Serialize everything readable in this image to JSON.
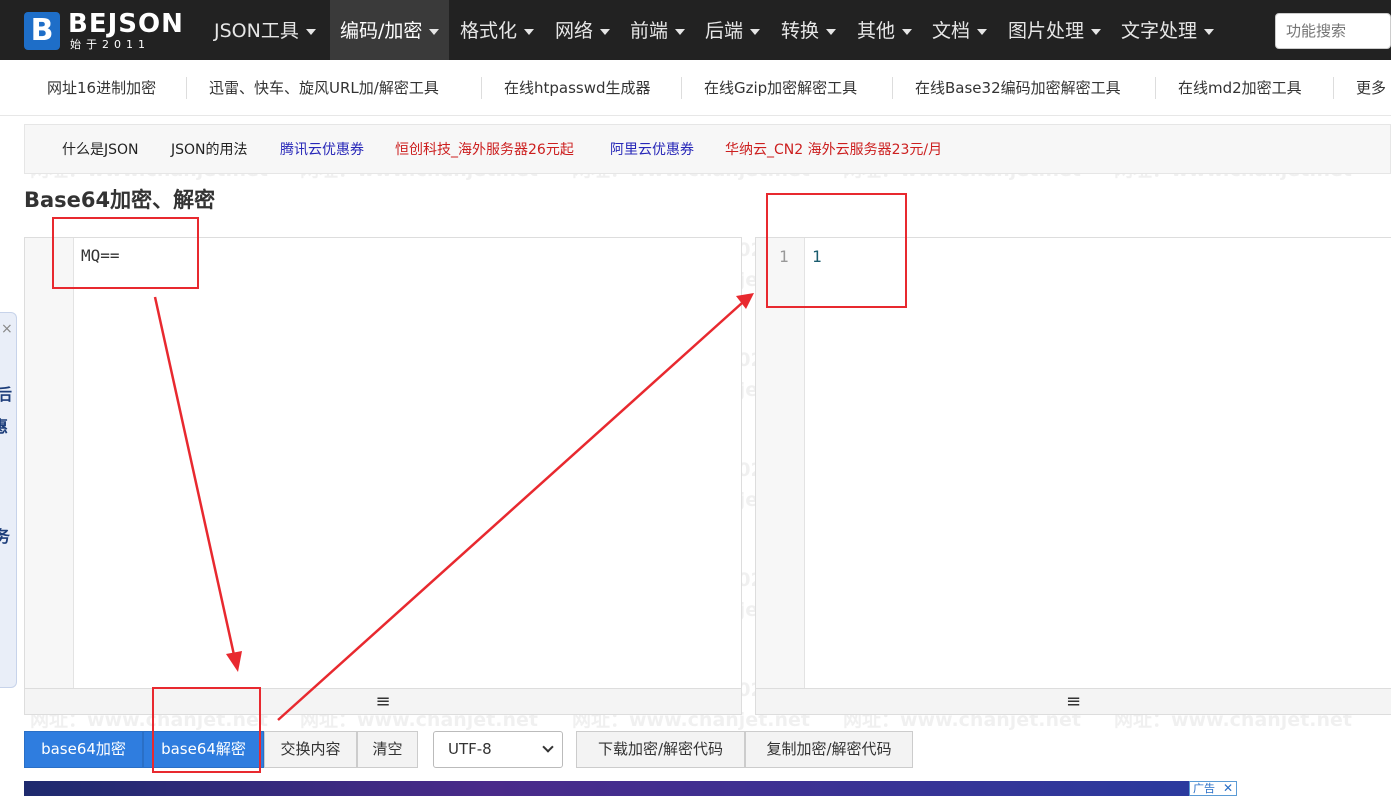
{
  "logo": {
    "box": "B",
    "main": "BEJSON",
    "sub": "始于2011"
  },
  "nav": {
    "items": [
      {
        "label": "JSON工具"
      },
      {
        "label": "编码/加密"
      },
      {
        "label": "格式化"
      },
      {
        "label": "网络"
      },
      {
        "label": "前端"
      },
      {
        "label": "后端"
      },
      {
        "label": "转换"
      },
      {
        "label": "其他"
      },
      {
        "label": "文档"
      },
      {
        "label": "图片处理"
      },
      {
        "label": "文字处理"
      }
    ],
    "search_placeholder": "功能搜索"
  },
  "subnav": {
    "items": [
      "网址16进制加密",
      "迅雷、快车、旋风URL加/解密工具",
      "在线htpasswd生成器",
      "在线Gzip加密解密工具",
      "在线Base32编码加密解密工具",
      "在线md2加密工具",
      "更多"
    ]
  },
  "links": {
    "items": [
      "什么是JSON",
      "JSON的用法",
      "腾讯云优惠券",
      "恒创科技_海外服务器26元起",
      "阿里云优惠券",
      "华纳云_CN2 海外云服务器23元/月"
    ]
  },
  "page": {
    "title": "Base64加密、解密"
  },
  "input_editor": {
    "text": "MQ=="
  },
  "output_editor": {
    "line_number": "1",
    "text": "1"
  },
  "resizer_glyph": "≡",
  "buttons": {
    "encode": "base64加密",
    "decode": "base64解密",
    "swap": "交换内容",
    "clear": "清空",
    "charset": "UTF-8",
    "download": "下载加密/解密代码",
    "copy": "复制加密/解密代码"
  },
  "ad": {
    "tag": "广告"
  },
  "side_widget": {
    "chars": [
      "×",
      "后",
      "惠",
      "务"
    ]
  },
  "watermark": {
    "phone": "电话：400-665-0028",
    "site": "网址：www.chanjet.net"
  },
  "colors": {
    "navbar": "#222222",
    "primary": "#2f7ddf",
    "annotation": "#e8292f",
    "link_blue": "#2828b8",
    "link_red": "#cc1f1f"
  }
}
